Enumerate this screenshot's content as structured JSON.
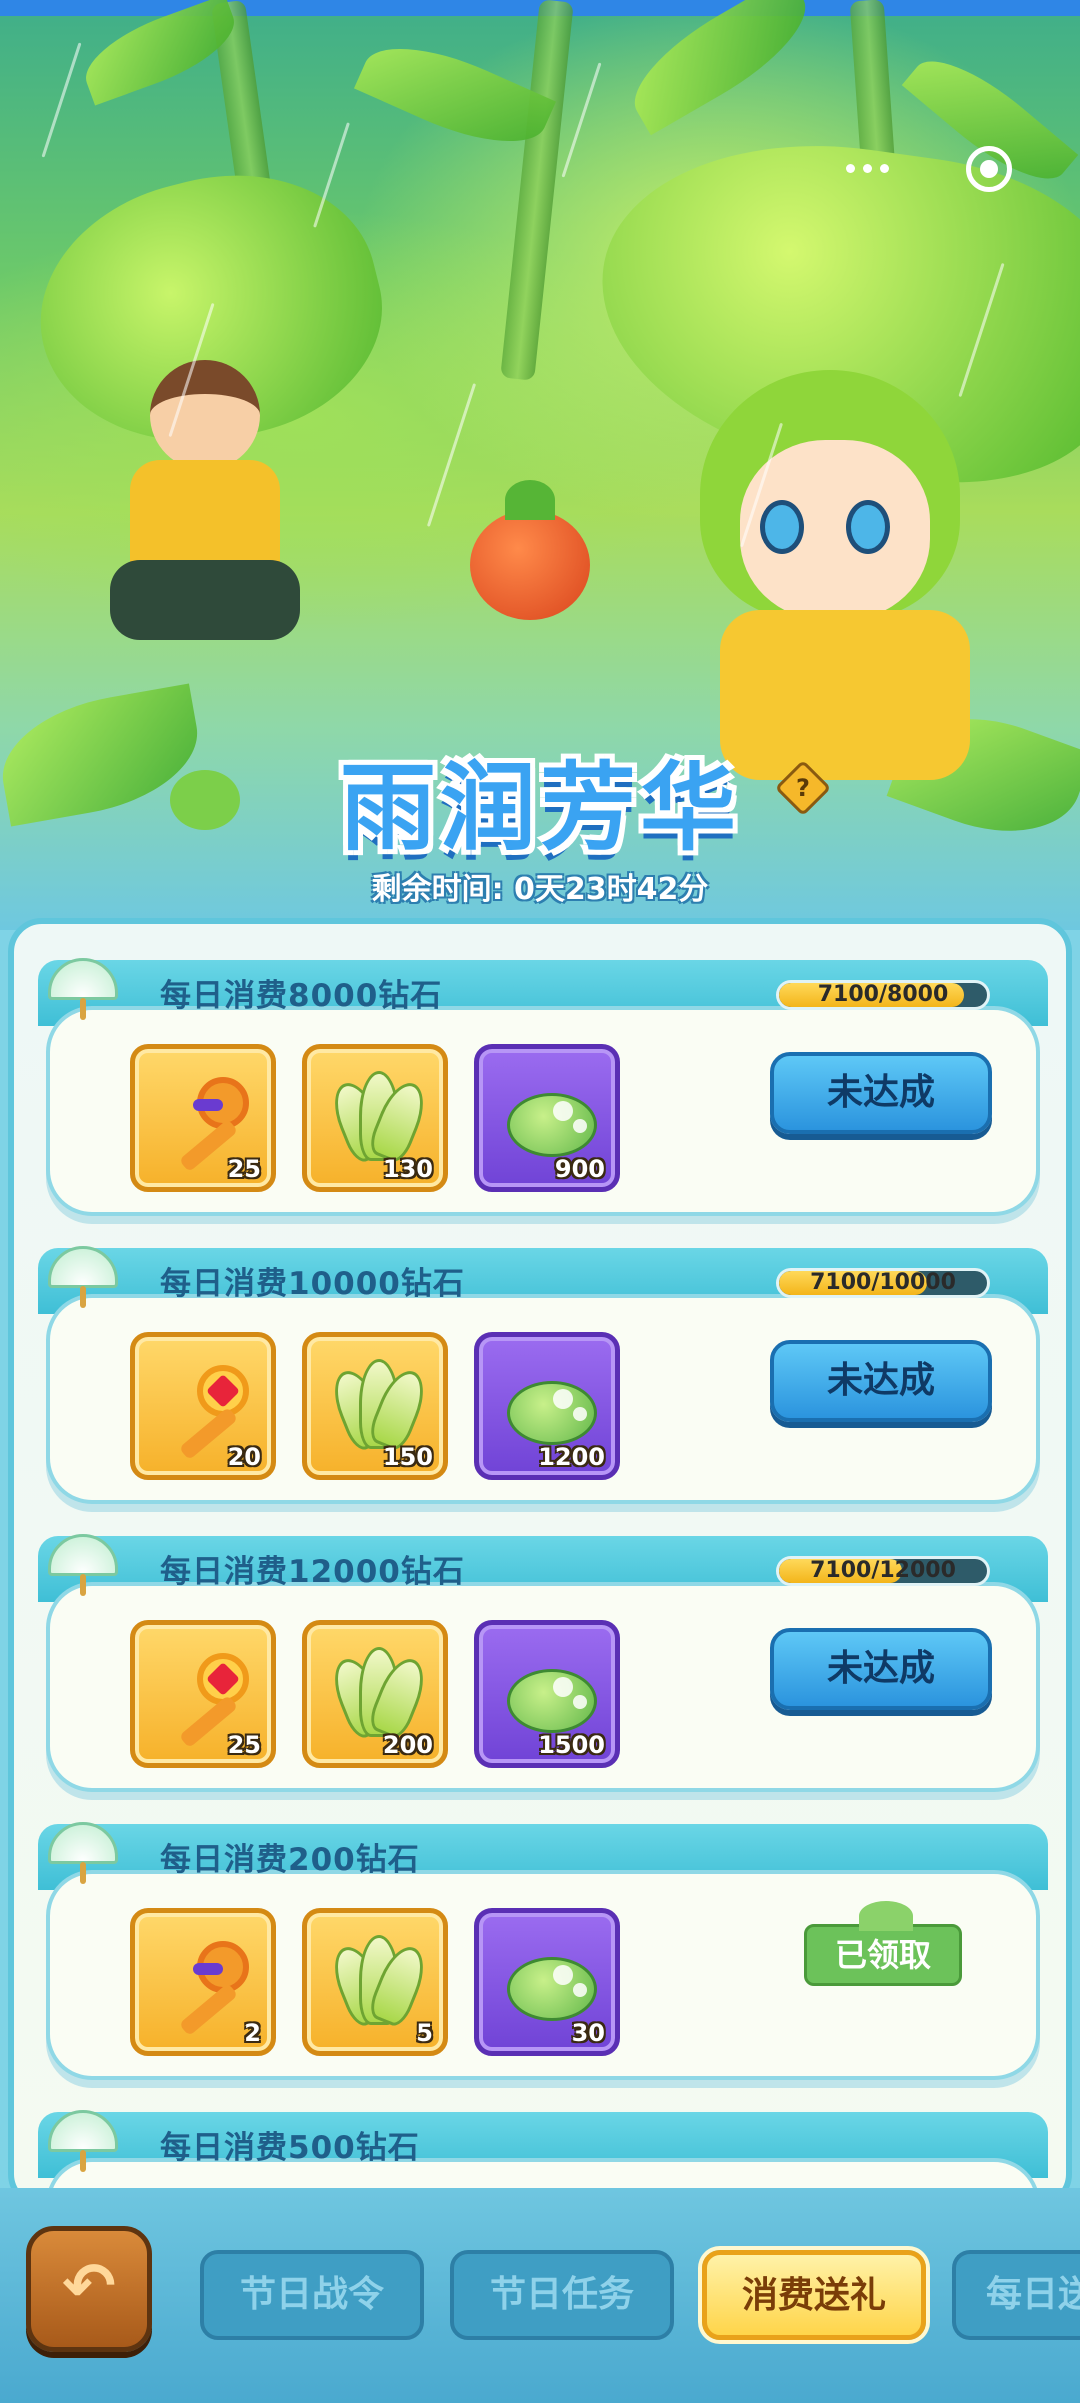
{
  "event": {
    "title": "雨润芳华",
    "countdown": "剩余时间: 0天23时42分",
    "help_icon": "?"
  },
  "top_controls": {
    "more_icon": "more-dots-icon",
    "close_icon": "target-close-icon"
  },
  "tasks": [
    {
      "title": "每日消费8000钻石",
      "progress_text": "7100/8000",
      "progress": 0.8875,
      "rewards": [
        {
          "icon": "bronze-key-icon",
          "count": "25"
        },
        {
          "icon": "bamboo-shoot-icon",
          "count": "130"
        },
        {
          "icon": "lily-pad-icon",
          "count": "900"
        }
      ],
      "button": "未达成"
    },
    {
      "title": "每日消费10000钻石",
      "progress_text": "7100/10000",
      "progress": 0.71,
      "rewards": [
        {
          "icon": "ruby-key-icon",
          "count": "20"
        },
        {
          "icon": "bamboo-shoot-icon",
          "count": "150"
        },
        {
          "icon": "lily-pad-icon",
          "count": "1200"
        }
      ],
      "button": "未达成"
    },
    {
      "title": "每日消费12000钻石",
      "progress_text": "7100/12000",
      "progress": 0.5917,
      "rewards": [
        {
          "icon": "ruby-key-icon",
          "count": "25"
        },
        {
          "icon": "bamboo-shoot-icon",
          "count": "200"
        },
        {
          "icon": "lily-pad-icon",
          "count": "1500"
        }
      ],
      "button": "未达成"
    },
    {
      "title": "每日消费200钻石",
      "rewards": [
        {
          "icon": "bronze-key-icon",
          "count": "2"
        },
        {
          "icon": "bamboo-shoot-icon",
          "count": "5"
        },
        {
          "icon": "lily-pad-icon",
          "count": "30"
        }
      ],
      "status": "已领取"
    },
    {
      "title": "每日消费500钻石"
    }
  ],
  "nav": {
    "back_icon": "back-arrow-icon",
    "tabs": [
      "节日战令",
      "节日任务",
      "消费送礼",
      "每日送"
    ],
    "active_tab": "消费送礼"
  },
  "colors": {
    "accent_blue": "#2b94de",
    "gold": "#f6b12a",
    "purple": "#7043d6",
    "claimed_green": "#6cc25a",
    "header_teal": "#3fbfd6"
  }
}
